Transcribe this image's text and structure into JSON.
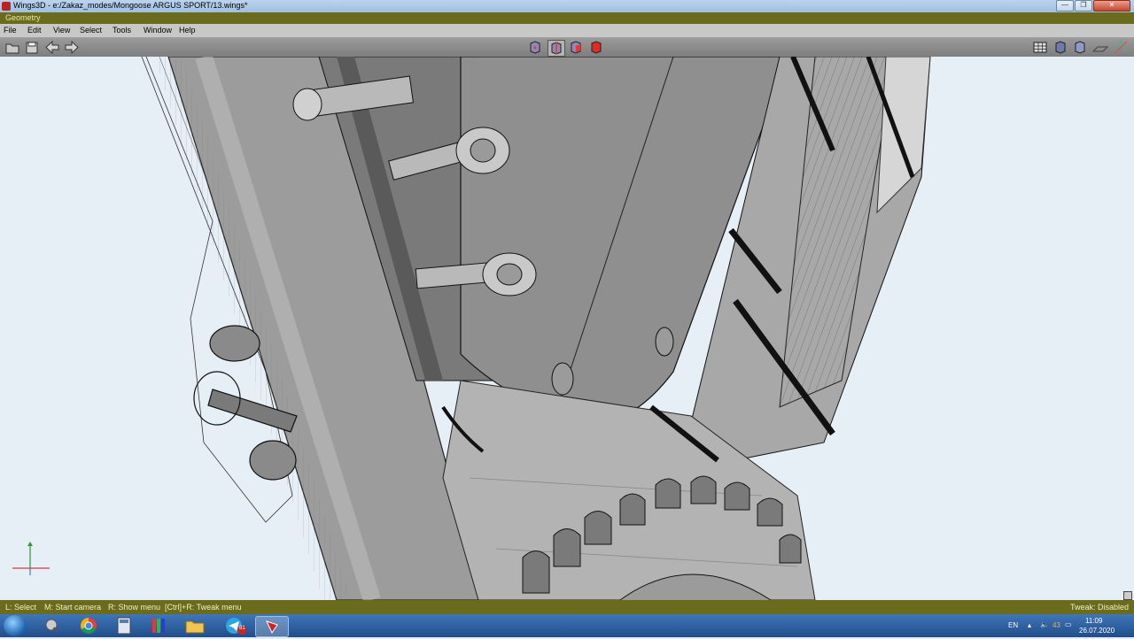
{
  "window": {
    "title": "Wings3D - e:/Zakaz_modes/Mongoose ARGUS SPORT/13.wings*"
  },
  "geometry_header": {
    "label": "Geometry"
  },
  "menu": {
    "items": [
      "File",
      "Edit",
      "View",
      "Select",
      "Tools",
      "Window",
      "Help"
    ]
  },
  "toolbar": {
    "left_icons": [
      "open-icon",
      "save-icon",
      "undo-icon",
      "redo-icon"
    ],
    "selection_modes": [
      "vertex-mode-icon",
      "edge-mode-icon",
      "face-mode-icon",
      "body-mode-icon"
    ],
    "right_icons": [
      "grid-icon",
      "smooth-shade-icon",
      "wire-shade-icon",
      "groundplane-icon",
      "perspective-icon"
    ]
  },
  "status": {
    "left": "L: Select",
    "middle": "M: Start camera",
    "right": "R: Show menu",
    "ctrl": "[Ctrl]+R: Tweak menu",
    "tweak": "Tweak: Disabled"
  },
  "taskbar": {
    "apps": [
      "chrome-icon",
      "calculator-icon",
      "app-icon",
      "folder-icon",
      "telegram-icon",
      "wings3d-icon"
    ],
    "telegram_badge": "81",
    "lang": "EN",
    "volume": "43",
    "time": "11:09",
    "date": "26.07.2020"
  },
  "colors": {
    "title_bg": "#a9c6e8",
    "geometry_header_bg": "#6b6b1e",
    "viewport_bg": "#e6eef6",
    "accent_red": "#d42020"
  }
}
